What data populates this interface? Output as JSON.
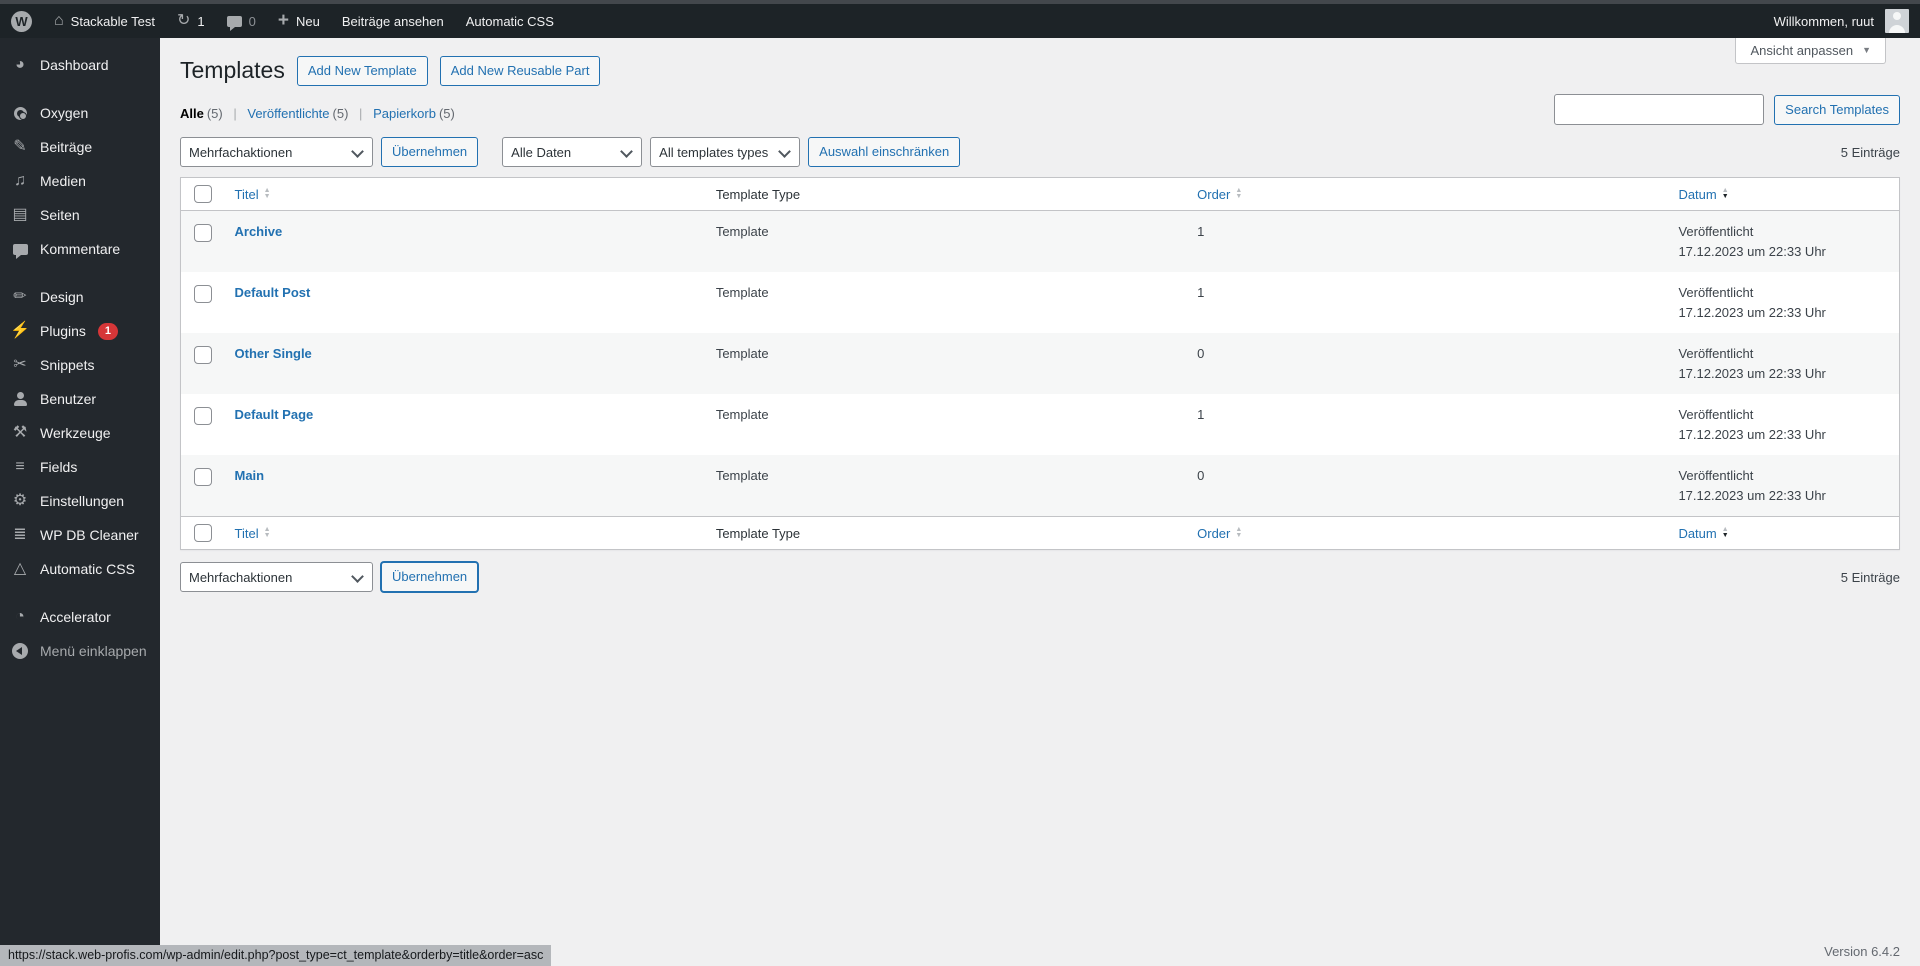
{
  "colors": {
    "accent_blue": "#2271b1",
    "badge_red": "#d63638",
    "admin_bar_bg": "#1d2327",
    "sidebar_bg": "#23282d",
    "content_bg": "#f0f0f1",
    "row_stripe": "#f6f7f7"
  },
  "admin_bar": {
    "site_name": "Stackable Test",
    "updates_count": "1",
    "comments_count": "0",
    "new_label": "Neu",
    "view_posts_label": "Beiträge ansehen",
    "automatic_css_label": "Automatic CSS",
    "greeting": "Willkommen, ruut"
  },
  "sidebar": {
    "items": [
      {
        "id": "dashboard",
        "label": "Dashboard",
        "icon": "dashboard-icon"
      },
      {
        "id": "oxygen",
        "label": "Oxygen",
        "icon": "oxygen-icon",
        "gap_before": true
      },
      {
        "id": "beitraege",
        "label": "Beiträge",
        "icon": "pushpin-icon"
      },
      {
        "id": "medien",
        "label": "Medien",
        "icon": "media-icon"
      },
      {
        "id": "seiten",
        "label": "Seiten",
        "icon": "pages-icon"
      },
      {
        "id": "kommentare",
        "label": "Kommentare",
        "icon": "comments-icon"
      },
      {
        "id": "design",
        "label": "Design",
        "icon": "paintbrush-icon",
        "gap_before": true
      },
      {
        "id": "plugins",
        "label": "Plugins",
        "icon": "plugin-icon",
        "badge": "1"
      },
      {
        "id": "snippets",
        "label": "Snippets",
        "icon": "scissors-icon"
      },
      {
        "id": "benutzer",
        "label": "Benutzer",
        "icon": "user-icon"
      },
      {
        "id": "werkzeuge",
        "label": "Werkzeuge",
        "icon": "tools-icon"
      },
      {
        "id": "fields",
        "label": "Fields",
        "icon": "list-icon"
      },
      {
        "id": "einstellungen",
        "label": "Einstellungen",
        "icon": "settings-icon"
      },
      {
        "id": "wp-db-cleaner",
        "label": "WP DB Cleaner",
        "icon": "database-icon"
      },
      {
        "id": "automatic-css",
        "label": "Automatic CSS",
        "icon": "automatic-css-icon"
      },
      {
        "id": "accelerator",
        "label": "Accelerator",
        "icon": "speedometer-icon",
        "gap_before": true
      },
      {
        "id": "menu-einklappen",
        "label": "Menü einklappen",
        "icon": "collapse-arrow-icon",
        "dim": true
      }
    ]
  },
  "page": {
    "title": "Templates",
    "add_new_template_label": "Add New Template",
    "add_new_reusable_label": "Add New Reusable Part",
    "screen_options_label": "Ansicht anpassen",
    "views": [
      {
        "label": "Alle",
        "count": "(5)"
      },
      {
        "label": "Veröffentlichte",
        "count": "(5)"
      },
      {
        "label": "Papierkorb",
        "count": "(5)"
      }
    ],
    "view_separator": "|",
    "search_button_label": "Search Templates",
    "filters": {
      "bulk_action": "Mehrfachaktionen",
      "apply_label": "Übernehmen",
      "date_filter": "Alle Daten",
      "type_filter": "All templates types",
      "filter_button_label": "Auswahl einschränken"
    },
    "items_count": "5 Einträge",
    "table": {
      "headers": {
        "title": "Titel",
        "type": "Template Type",
        "order": "Order",
        "date": "Datum"
      },
      "rows": [
        {
          "title": "Archive",
          "type": "Template",
          "order": "1",
          "status": "Veröffentlicht",
          "date": "17.12.2023 um 22:33 Uhr"
        },
        {
          "title": "Default Post",
          "type": "Template",
          "order": "1",
          "status": "Veröffentlicht",
          "date": "17.12.2023 um 22:33 Uhr"
        },
        {
          "title": "Other Single",
          "type": "Template",
          "order": "0",
          "status": "Veröffentlicht",
          "date": "17.12.2023 um 22:33 Uhr"
        },
        {
          "title": "Default Page",
          "type": "Template",
          "order": "1",
          "status": "Veröffentlicht",
          "date": "17.12.2023 um 22:33 Uhr"
        },
        {
          "title": "Main",
          "type": "Template",
          "order": "0",
          "status": "Veröffentlicht",
          "date": "17.12.2023 um 22:33 Uhr"
        }
      ]
    }
  },
  "footer": {
    "version": "Version 6.4.2"
  },
  "status_bar": {
    "url": "https://stack.web-profis.com/wp-admin/edit.php?post_type=ct_template&orderby=title&order=asc"
  }
}
